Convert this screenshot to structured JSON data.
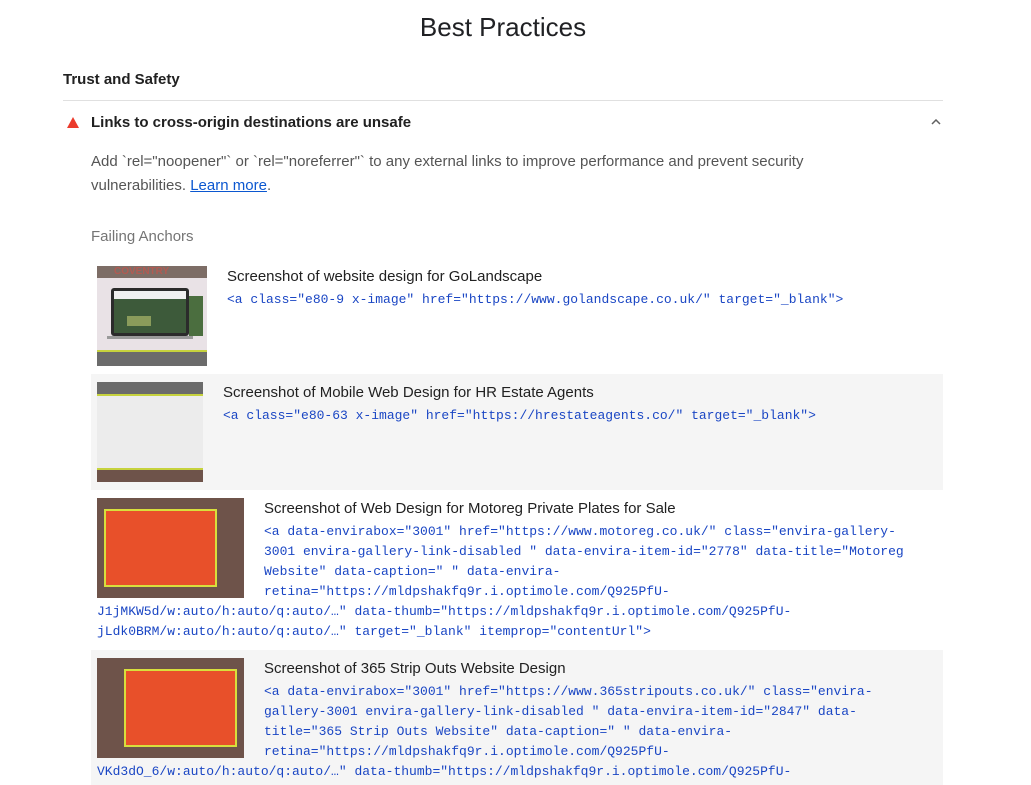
{
  "page": {
    "title": "Best Practices",
    "group_title": "Trust and Safety"
  },
  "audit": {
    "title": "Links to cross-origin destinations are unsafe",
    "status_icon": "fail-triangle-icon",
    "status_color": "#eb3b2c",
    "description_text": "Add `rel=\"noopener\"` or `rel=\"noreferrer\"` to any external links to improve performance and prevent security vulnerabilities. ",
    "learn_more": "Learn more",
    "description_end": ".",
    "expanded_icon": "chevron-up-icon"
  },
  "table": {
    "label": "Failing Anchors",
    "rows": [
      {
        "label": "Screenshot of website design for GoLandscape",
        "lines": [
          "<a class=\"e80-9 x-image\" href=\"https://www.golandscape.co.uk/\" target=\"_blank\">"
        ]
      },
      {
        "label": "Screenshot of Mobile Web Design for HR Estate Agents",
        "lines": [
          "<a class=\"e80-63 x-image\" href=\"https://hrestateagents.co/\" target=\"_blank\">"
        ]
      },
      {
        "label": "Screenshot of Web Design for Motoreg Private Plates for Sale",
        "lines": [
          "<a data-envirabox=\"3001\" href=\"https://www.motoreg.co.uk/\" class=\"envira-gallery-",
          "3001 envira-gallery-link-disabled \" data-envira-item-id=\"2778\" data-title=\"Motoreg",
          "Website\" data-caption=\" \" data-envira-",
          "retina=\"https://mldpshakfq9r.i.optimole.com/Q925PfU-",
          "J1jMKW5d/w:auto/h:auto/q:auto/…\" data-thumb=\"https://mldpshakfq9r.i.optimole.com/Q925PfU-",
          "jLdk0BRM/w:auto/h:auto/q:auto/…\" target=\"_blank\" itemprop=\"contentUrl\">"
        ]
      },
      {
        "label": "Screenshot of 365 Strip Outs Website Design",
        "lines": [
          "<a data-envirabox=\"3001\" href=\"https://www.365stripouts.co.uk/\" class=\"envira-",
          "gallery-3001 envira-gallery-link-disabled \" data-envira-item-id=\"2847\" data-",
          "title=\"365 Strip Outs Website\" data-caption=\" \" data-envira-",
          "retina=\"https://mldpshakfq9r.i.optimole.com/Q925PfU-",
          "VKd3dO_6/w:auto/h:auto/q:auto/…\" data-thumb=\"https://mldpshakfq9r.i.optimole.com/Q925PfU-"
        ]
      }
    ],
    "thumb1_text": [
      "COVENTRY",
      "GREAT",
      "outdoors"
    ]
  },
  "colors": {
    "accent_link": "#0b57d0",
    "snippet": "#1a46c4",
    "fail": "#eb3b2c",
    "thumb_brown": "#6e534a",
    "thumb_orange": "#e8502a",
    "thumb_yellow": "#d8df3c"
  }
}
